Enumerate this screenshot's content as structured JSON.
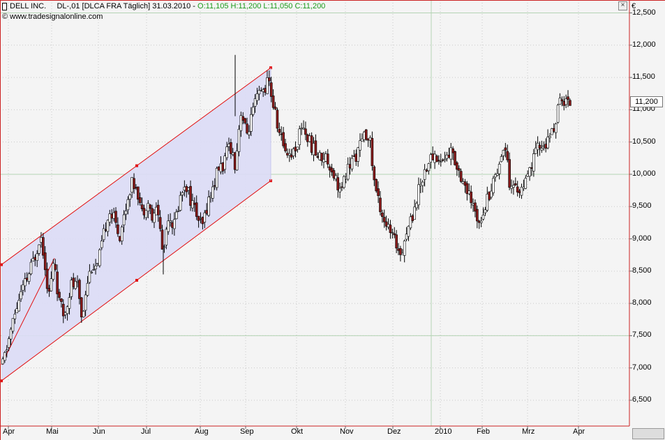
{
  "header": {
    "symbol": "DELL INC.",
    "details": "DL-,01 [DLCA FRA  Täglich] 31.03.2010 -",
    "ohlc": "O:11,105 H:11,200 L:11,050 C:11,200"
  },
  "watermark": "© www.tradesignalonline.com",
  "currency": "€",
  "colors": {
    "up": "#ffffff",
    "down": "#8a1a1a",
    "channel_fill": "#dcdcf6",
    "channel_line": "#e21010",
    "axis_border": "#cc2222",
    "grid": "#c9c9c9",
    "hline": "#b3d3b3"
  },
  "chart_data": {
    "type": "candlestick",
    "title": "DELL INC.",
    "ylim": [
      6.1,
      12.7
    ],
    "y_ticks": [
      "6,500",
      "7,000",
      "7,500",
      "8,000",
      "8,500",
      "9,000",
      "9,500",
      "10,000",
      "10,500",
      "11,000",
      "11,500",
      "12,000",
      "12,500"
    ],
    "y_tick_values": [
      6.5,
      7.0,
      7.5,
      8.0,
      8.5,
      9.0,
      9.5,
      10.0,
      10.5,
      11.0,
      11.5,
      12.0,
      12.5
    ],
    "x_labels": [
      "Apr",
      "Mai",
      "Jun",
      "Jul",
      "Aug",
      "Sep",
      "Okt",
      "Nov",
      "Dez",
      "2010",
      "Feb",
      "Mrz",
      "Apr"
    ],
    "grid": true,
    "last_value": "11,200",
    "trend_channel": {
      "start_label": "Apr",
      "end_label": "Sep",
      "upper": [
        8.6,
        11.65
      ],
      "middle": [
        7.05,
        10.1
      ],
      "lower": [
        6.8,
        9.9
      ]
    },
    "anchors": [
      [
        0,
        7.05
      ],
      [
        12,
        7.6
      ],
      [
        24,
        8.1
      ],
      [
        36,
        8.4
      ],
      [
        48,
        8.8
      ],
      [
        54,
        9.1
      ],
      [
        60,
        8.7
      ],
      [
        66,
        8.1
      ],
      [
        74,
        8.7
      ],
      [
        80,
        8.05
      ],
      [
        88,
        7.8
      ],
      [
        98,
        8.3
      ],
      [
        108,
        8.25
      ],
      [
        114,
        7.75
      ],
      [
        120,
        8.3
      ],
      [
        128,
        8.6
      ],
      [
        136,
        8.55
      ],
      [
        144,
        9.0
      ],
      [
        152,
        9.45
      ],
      [
        160,
        9.3
      ],
      [
        168,
        9.05
      ],
      [
        176,
        9.45
      ],
      [
        184,
        9.85
      ],
      [
        192,
        9.85
      ],
      [
        200,
        9.4
      ],
      [
        208,
        9.6
      ],
      [
        216,
        9.25
      ],
      [
        222,
        9.55
      ],
      [
        230,
        8.75
      ],
      [
        238,
        9.4
      ],
      [
        246,
        9.2
      ],
      [
        254,
        9.6
      ],
      [
        262,
        9.9
      ],
      [
        270,
        9.6
      ],
      [
        278,
        9.4
      ],
      [
        286,
        9.15
      ],
      [
        294,
        9.55
      ],
      [
        302,
        9.8
      ],
      [
        310,
        10.1
      ],
      [
        318,
        10.15
      ],
      [
        326,
        10.5
      ],
      [
        334,
        10.15
      ],
      [
        342,
        11.0
      ],
      [
        350,
        10.6
      ],
      [
        358,
        10.9
      ],
      [
        366,
        11.2
      ],
      [
        374,
        11.3
      ],
      [
        382,
        11.45
      ],
      [
        390,
        11.0
      ],
      [
        398,
        10.6
      ],
      [
        406,
        10.4
      ],
      [
        414,
        10.3
      ],
      [
        422,
        10.45
      ],
      [
        430,
        10.8
      ],
      [
        438,
        10.55
      ],
      [
        446,
        10.4
      ],
      [
        454,
        10.25
      ],
      [
        462,
        10.3
      ],
      [
        470,
        10.15
      ],
      [
        478,
        9.95
      ],
      [
        486,
        9.7
      ],
      [
        494,
        10.05
      ],
      [
        502,
        10.2
      ],
      [
        510,
        10.35
      ],
      [
        518,
        10.55
      ],
      [
        526,
        10.65
      ],
      [
        534,
        9.85
      ],
      [
        542,
        9.5
      ],
      [
        550,
        9.25
      ],
      [
        558,
        9.05
      ],
      [
        566,
        8.9
      ],
      [
        572,
        8.8
      ],
      [
        580,
        9.1
      ],
      [
        588,
        9.35
      ],
      [
        596,
        9.7
      ],
      [
        604,
        10.0
      ],
      [
        612,
        10.2
      ],
      [
        620,
        10.3
      ],
      [
        628,
        10.2
      ],
      [
        636,
        10.25
      ],
      [
        644,
        10.35
      ],
      [
        652,
        10.15
      ],
      [
        660,
        9.95
      ],
      [
        668,
        9.7
      ],
      [
        676,
        9.45
      ],
      [
        684,
        9.3
      ],
      [
        692,
        9.5
      ],
      [
        700,
        9.75
      ],
      [
        708,
        10.0
      ],
      [
        716,
        10.3
      ],
      [
        724,
        10.45
      ],
      [
        728,
        9.85
      ],
      [
        736,
        9.8
      ],
      [
        744,
        9.75
      ],
      [
        752,
        9.85
      ],
      [
        760,
        10.15
      ],
      [
        768,
        10.4
      ],
      [
        776,
        10.45
      ],
      [
        784,
        10.5
      ],
      [
        792,
        10.75
      ],
      [
        800,
        11.1
      ],
      [
        808,
        11.15
      ],
      [
        816,
        11.1
      ]
    ]
  }
}
